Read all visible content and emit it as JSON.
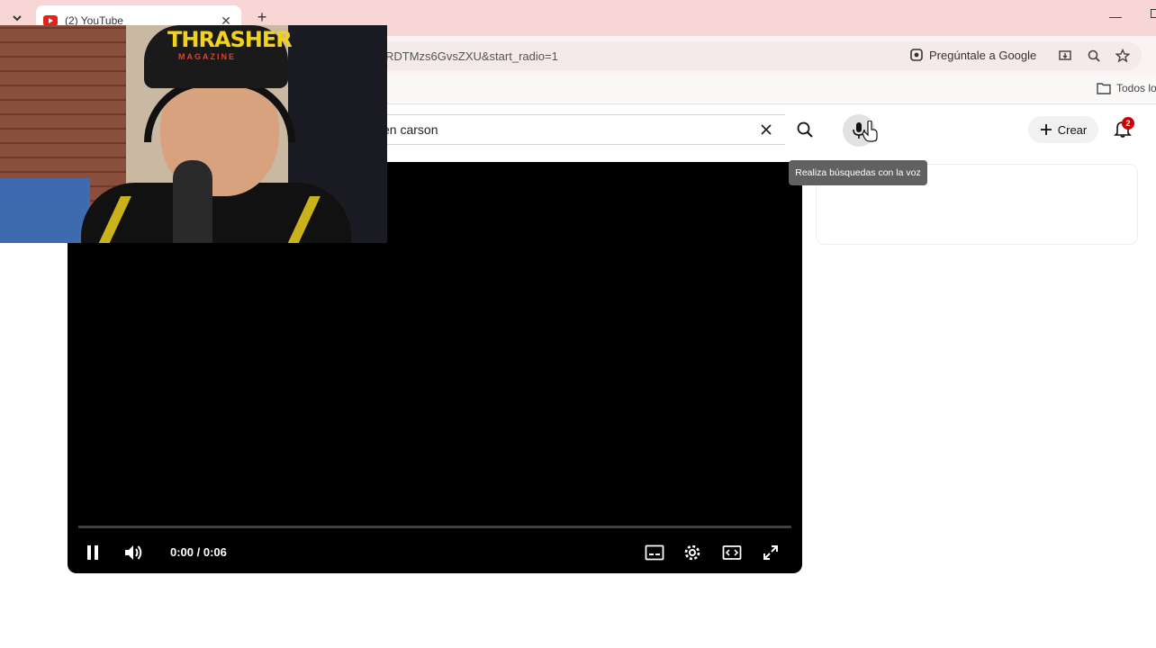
{
  "browser": {
    "tab_title": "(2) YouTube",
    "tab_close": "✕",
    "new_tab": "+",
    "url_visible": "RDTMzs6GvsZXU&start_radio=1",
    "ask_google": "Pregúntale a Google",
    "bookmarks_all": "Todos lo"
  },
  "youtube": {
    "search_value": "en carson",
    "create_label": "Crear",
    "notification_count": "2",
    "mic_tooltip": "Realiza búsquedas con la voz"
  },
  "player": {
    "time_display": "0:00 / 0:06",
    "progress_fraction": 0
  },
  "webcam": {
    "cap_text": "THRASHER",
    "cap_subtext": "MAGAZINE"
  },
  "colors": {
    "tabstrip": "#f8d6d6",
    "youtube_red": "#e62117",
    "player_bg": "#000000",
    "tooltip_bg": "#616161"
  }
}
